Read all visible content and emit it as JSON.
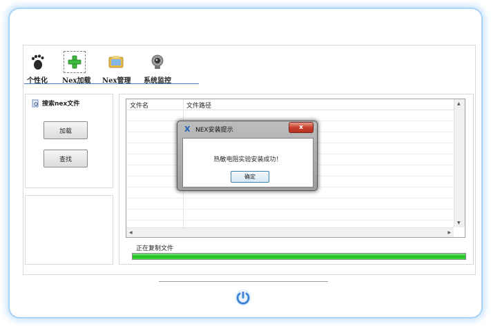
{
  "toolbar": {
    "items": [
      {
        "label": "个性化",
        "icon": "footprint-icon"
      },
      {
        "label": "Nex加载",
        "icon": "plus-icon"
      },
      {
        "label": "Nex管理",
        "icon": "folder-icon"
      },
      {
        "label": "系统监控",
        "icon": "webcam-icon"
      }
    ]
  },
  "left_panel": {
    "title": "搜索nex文件",
    "load_button": "加载",
    "find_button": "查找"
  },
  "file_list": {
    "columns": [
      "文件名",
      "文件路径"
    ]
  },
  "status": {
    "text": "正在复制文件",
    "progress": 1.0
  },
  "dialog": {
    "title": "NEX安装提示",
    "close": "x",
    "message": "热敏电阻实验安装成功！",
    "ok_button": "确定"
  },
  "colors": {
    "accent": "#3b78c2",
    "progress": "#19c219",
    "close_button": "#c7402c"
  }
}
